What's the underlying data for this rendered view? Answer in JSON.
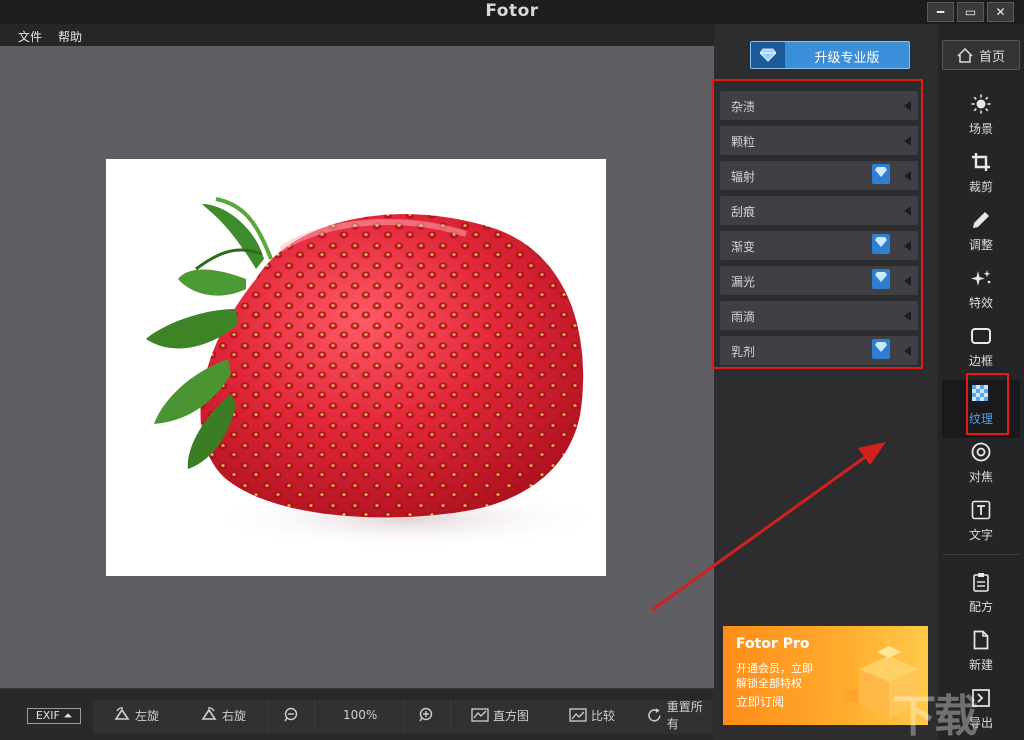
{
  "window": {
    "title": "Fotor",
    "minimize": "━",
    "maximize": "▭",
    "close": "✕"
  },
  "menu": [
    "文件",
    "帮助"
  ],
  "bottombar": {
    "exif": "EXIF ⏶",
    "rotate_left": "左旋",
    "rotate_right": "右旋",
    "zoom_level": "100%",
    "histogram": "直方图",
    "compare": "比较",
    "reset": "重置所有"
  },
  "panel": {
    "upgrade_label": "升级专业版",
    "textures": [
      {
        "label": "杂渍",
        "pro": false
      },
      {
        "label": "颗粒",
        "pro": false
      },
      {
        "label": "辐射",
        "pro": true
      },
      {
        "label": "刮痕",
        "pro": false
      },
      {
        "label": "渐变",
        "pro": true
      },
      {
        "label": "漏光",
        "pro": true
      },
      {
        "label": "雨滴",
        "pro": false
      },
      {
        "label": "乳剂",
        "pro": true
      }
    ]
  },
  "promo": {
    "title": "Fotor Pro",
    "line1": "开通会员，立即",
    "line2": "解锁全部特权",
    "cta": "立即订阅"
  },
  "nav": {
    "home": "首页",
    "items": [
      {
        "label": "场景",
        "icon": "sun-icon"
      },
      {
        "label": "裁剪",
        "icon": "crop-icon"
      },
      {
        "label": "调整",
        "icon": "pencil-icon"
      },
      {
        "label": "特效",
        "icon": "sparkle-icon"
      },
      {
        "label": "边框",
        "icon": "frame-icon"
      },
      {
        "label": "纹理",
        "icon": "texture-icon",
        "active": true
      },
      {
        "label": "对焦",
        "icon": "focus-icon"
      },
      {
        "label": "文字",
        "icon": "text-icon"
      },
      {
        "label": "配方",
        "icon": "recipe-icon"
      },
      {
        "label": "新建",
        "icon": "new-file-icon"
      },
      {
        "label": "导出",
        "icon": "export-icon"
      }
    ]
  },
  "watermark": "下载",
  "colors": {
    "accent": "#3b8fd9",
    "highlight": "#e21b1b",
    "active_label": "#4aa3f0"
  }
}
